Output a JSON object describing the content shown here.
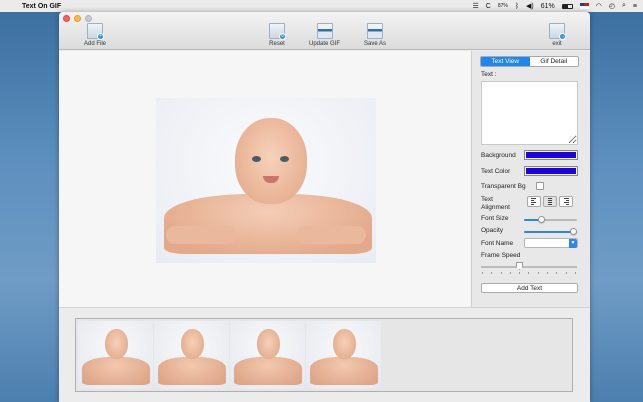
{
  "menubar": {
    "app_name": "Text On GIF",
    "battery": "61%",
    "network": "87%",
    "icons": [
      "apple-icon",
      "menu-lines-icon",
      "c-icon",
      "network-stats-icon",
      "bluetooth-icon",
      "volume-icon",
      "battery-icon",
      "flag-icon",
      "wifi-icon",
      "time-machine-icon",
      "search-icon",
      "list-icon"
    ]
  },
  "toolbar": {
    "add_file": "Add File",
    "reset": "Reset",
    "update_gif": "Update GIF",
    "save_as": "Save As",
    "exit": "exit"
  },
  "panel": {
    "tabs": [
      "Text View",
      "Gif Detail"
    ],
    "active_tab": "Text View",
    "text_label": "Text :",
    "text_value": "",
    "background_label": "Background",
    "background_color": "#1e00e6",
    "text_color_label": "Text Color",
    "text_color_value": "#1e00e6",
    "transparent_bg_label": "Transparent Bg",
    "transparent_bg_checked": false,
    "alignment_label_1": "Text",
    "alignment_label_2": "Alignment",
    "alignment_selected": "center",
    "font_size_label": "Font Size",
    "font_size_level": 0.32,
    "opacity_label": "Opacity",
    "opacity_level": 1.0,
    "font_name_label": "Font Name",
    "font_name_value": "",
    "frame_speed_label": "Frame Speed",
    "frame_speed_level": 0.5,
    "add_text_button": "Add Text"
  },
  "frames": {
    "count": 4
  },
  "colors": {
    "accent": "#1f86f0",
    "close": "#fc605c",
    "minimize": "#fdbc40"
  }
}
